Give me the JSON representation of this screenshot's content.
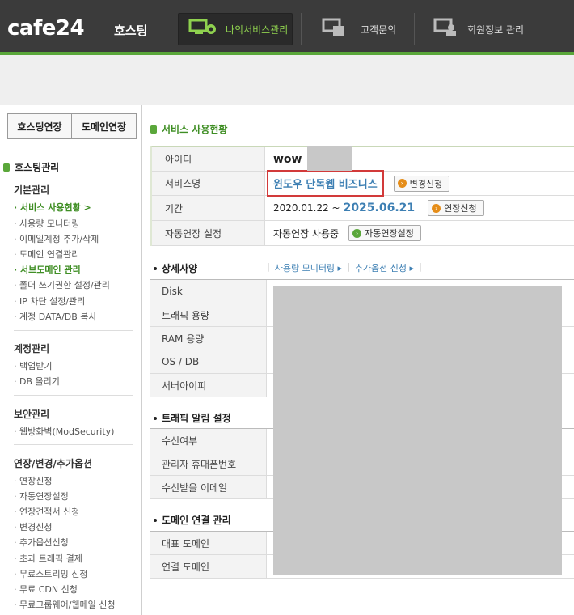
{
  "header": {
    "logo": "cafe24",
    "logo_sub": "호스팅",
    "nav": [
      {
        "label": "나의서비스관리",
        "icon": "monitor-gear-icon",
        "active": true
      },
      {
        "label": "고객문의",
        "icon": "support-icon",
        "active": false
      },
      {
        "label": "회원정보 관리",
        "icon": "member-icon",
        "active": false
      }
    ]
  },
  "sidebar": {
    "buttons": [
      "호스팅연장",
      "도메인연장"
    ],
    "heading": "호스팅관리",
    "groups": [
      {
        "title": "기본관리",
        "items": [
          "서비스 사용현황",
          "사용량 모니터링",
          "이메일계정 추가/삭제",
          "도메인 연결관리",
          "서브도메인 관리",
          "폴더 쓰기권한 설정/관리",
          "IP 차단 설정/관리",
          "계정 DATA/DB 복사"
        ]
      },
      {
        "title": "계정관리",
        "items": [
          "백업받기",
          "DB 올리기"
        ]
      },
      {
        "title": "보안관리",
        "items": [
          "웹방화벽(ModSecurity)"
        ]
      },
      {
        "title": "연장/변경/추가옵션",
        "items": [
          "연장신청",
          "자동연장설정",
          "연장견적서 신청",
          "변경신청",
          "추가옵션신청",
          "초과 트래픽 결제",
          "무료스트리밍 신청",
          "무료 CDN 신청",
          "무료그룹웨어/웹메일 신청"
        ]
      }
    ]
  },
  "main": {
    "title": "서비스 사용현황",
    "info": {
      "id_label": "아이디",
      "id_value": "wow",
      "service_label": "서비스명",
      "service_value": "윈도우 단독웹 비즈니스",
      "service_btn": "변경신청",
      "period_label": "기간",
      "period_start": "2020.01.22 ~",
      "period_end": "2025.06.21",
      "period_btn": "연장신청",
      "auto_label": "자동연장 설정",
      "auto_value": "자동연장 사용중",
      "auto_btn": "자동연장설정"
    },
    "spec": {
      "title": "상세사양",
      "links": [
        "사용량 모니터링 ▸",
        "추가옵션 신청 ▸"
      ],
      "rows": [
        "Disk",
        "트래픽 용량",
        "RAM 용량",
        "OS / DB",
        "서버아이피"
      ]
    },
    "traffic": {
      "title": "트래픽 알림 설정",
      "rows": [
        "수신여부",
        "관리자 휴대폰번호",
        "수신받을 이메일"
      ]
    },
    "domain": {
      "title": "도메인 연결 관리",
      "rows": [
        "대표 도메인",
        "연결 도메인"
      ]
    }
  }
}
